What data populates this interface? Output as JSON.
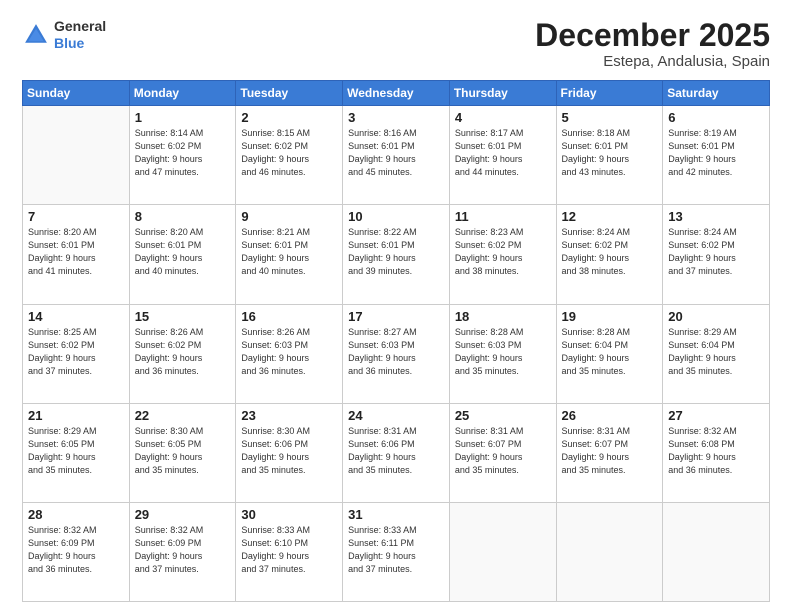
{
  "header": {
    "logo_general": "General",
    "logo_blue": "Blue",
    "month_year": "December 2025",
    "location": "Estepa, Andalusia, Spain"
  },
  "weekdays": [
    "Sunday",
    "Monday",
    "Tuesday",
    "Wednesday",
    "Thursday",
    "Friday",
    "Saturday"
  ],
  "weeks": [
    [
      {
        "day": "",
        "sunrise": "",
        "sunset": "",
        "daylight": ""
      },
      {
        "day": "1",
        "sunrise": "Sunrise: 8:14 AM",
        "sunset": "Sunset: 6:02 PM",
        "daylight": "Daylight: 9 hours and 47 minutes."
      },
      {
        "day": "2",
        "sunrise": "Sunrise: 8:15 AM",
        "sunset": "Sunset: 6:02 PM",
        "daylight": "Daylight: 9 hours and 46 minutes."
      },
      {
        "day": "3",
        "sunrise": "Sunrise: 8:16 AM",
        "sunset": "Sunset: 6:01 PM",
        "daylight": "Daylight: 9 hours and 45 minutes."
      },
      {
        "day": "4",
        "sunrise": "Sunrise: 8:17 AM",
        "sunset": "Sunset: 6:01 PM",
        "daylight": "Daylight: 9 hours and 44 minutes."
      },
      {
        "day": "5",
        "sunrise": "Sunrise: 8:18 AM",
        "sunset": "Sunset: 6:01 PM",
        "daylight": "Daylight: 9 hours and 43 minutes."
      },
      {
        "day": "6",
        "sunrise": "Sunrise: 8:19 AM",
        "sunset": "Sunset: 6:01 PM",
        "daylight": "Daylight: 9 hours and 42 minutes."
      }
    ],
    [
      {
        "day": "7",
        "sunrise": "Sunrise: 8:20 AM",
        "sunset": "Sunset: 6:01 PM",
        "daylight": "Daylight: 9 hours and 41 minutes."
      },
      {
        "day": "8",
        "sunrise": "Sunrise: 8:20 AM",
        "sunset": "Sunset: 6:01 PM",
        "daylight": "Daylight: 9 hours and 40 minutes."
      },
      {
        "day": "9",
        "sunrise": "Sunrise: 8:21 AM",
        "sunset": "Sunset: 6:01 PM",
        "daylight": "Daylight: 9 hours and 40 minutes."
      },
      {
        "day": "10",
        "sunrise": "Sunrise: 8:22 AM",
        "sunset": "Sunset: 6:01 PM",
        "daylight": "Daylight: 9 hours and 39 minutes."
      },
      {
        "day": "11",
        "sunrise": "Sunrise: 8:23 AM",
        "sunset": "Sunset: 6:02 PM",
        "daylight": "Daylight: 9 hours and 38 minutes."
      },
      {
        "day": "12",
        "sunrise": "Sunrise: 8:24 AM",
        "sunset": "Sunset: 6:02 PM",
        "daylight": "Daylight: 9 hours and 38 minutes."
      },
      {
        "day": "13",
        "sunrise": "Sunrise: 8:24 AM",
        "sunset": "Sunset: 6:02 PM",
        "daylight": "Daylight: 9 hours and 37 minutes."
      }
    ],
    [
      {
        "day": "14",
        "sunrise": "Sunrise: 8:25 AM",
        "sunset": "Sunset: 6:02 PM",
        "daylight": "Daylight: 9 hours and 37 minutes."
      },
      {
        "day": "15",
        "sunrise": "Sunrise: 8:26 AM",
        "sunset": "Sunset: 6:02 PM",
        "daylight": "Daylight: 9 hours and 36 minutes."
      },
      {
        "day": "16",
        "sunrise": "Sunrise: 8:26 AM",
        "sunset": "Sunset: 6:03 PM",
        "daylight": "Daylight: 9 hours and 36 minutes."
      },
      {
        "day": "17",
        "sunrise": "Sunrise: 8:27 AM",
        "sunset": "Sunset: 6:03 PM",
        "daylight": "Daylight: 9 hours and 36 minutes."
      },
      {
        "day": "18",
        "sunrise": "Sunrise: 8:28 AM",
        "sunset": "Sunset: 6:03 PM",
        "daylight": "Daylight: 9 hours and 35 minutes."
      },
      {
        "day": "19",
        "sunrise": "Sunrise: 8:28 AM",
        "sunset": "Sunset: 6:04 PM",
        "daylight": "Daylight: 9 hours and 35 minutes."
      },
      {
        "day": "20",
        "sunrise": "Sunrise: 8:29 AM",
        "sunset": "Sunset: 6:04 PM",
        "daylight": "Daylight: 9 hours and 35 minutes."
      }
    ],
    [
      {
        "day": "21",
        "sunrise": "Sunrise: 8:29 AM",
        "sunset": "Sunset: 6:05 PM",
        "daylight": "Daylight: 9 hours and 35 minutes."
      },
      {
        "day": "22",
        "sunrise": "Sunrise: 8:30 AM",
        "sunset": "Sunset: 6:05 PM",
        "daylight": "Daylight: 9 hours and 35 minutes."
      },
      {
        "day": "23",
        "sunrise": "Sunrise: 8:30 AM",
        "sunset": "Sunset: 6:06 PM",
        "daylight": "Daylight: 9 hours and 35 minutes."
      },
      {
        "day": "24",
        "sunrise": "Sunrise: 8:31 AM",
        "sunset": "Sunset: 6:06 PM",
        "daylight": "Daylight: 9 hours and 35 minutes."
      },
      {
        "day": "25",
        "sunrise": "Sunrise: 8:31 AM",
        "sunset": "Sunset: 6:07 PM",
        "daylight": "Daylight: 9 hours and 35 minutes."
      },
      {
        "day": "26",
        "sunrise": "Sunrise: 8:31 AM",
        "sunset": "Sunset: 6:07 PM",
        "daylight": "Daylight: 9 hours and 35 minutes."
      },
      {
        "day": "27",
        "sunrise": "Sunrise: 8:32 AM",
        "sunset": "Sunset: 6:08 PM",
        "daylight": "Daylight: 9 hours and 36 minutes."
      }
    ],
    [
      {
        "day": "28",
        "sunrise": "Sunrise: 8:32 AM",
        "sunset": "Sunset: 6:09 PM",
        "daylight": "Daylight: 9 hours and 36 minutes."
      },
      {
        "day": "29",
        "sunrise": "Sunrise: 8:32 AM",
        "sunset": "Sunset: 6:09 PM",
        "daylight": "Daylight: 9 hours and 37 minutes."
      },
      {
        "day": "30",
        "sunrise": "Sunrise: 8:33 AM",
        "sunset": "Sunset: 6:10 PM",
        "daylight": "Daylight: 9 hours and 37 minutes."
      },
      {
        "day": "31",
        "sunrise": "Sunrise: 8:33 AM",
        "sunset": "Sunset: 6:11 PM",
        "daylight": "Daylight: 9 hours and 37 minutes."
      },
      {
        "day": "",
        "sunrise": "",
        "sunset": "",
        "daylight": ""
      },
      {
        "day": "",
        "sunrise": "",
        "sunset": "",
        "daylight": ""
      },
      {
        "day": "",
        "sunrise": "",
        "sunset": "",
        "daylight": ""
      }
    ]
  ]
}
